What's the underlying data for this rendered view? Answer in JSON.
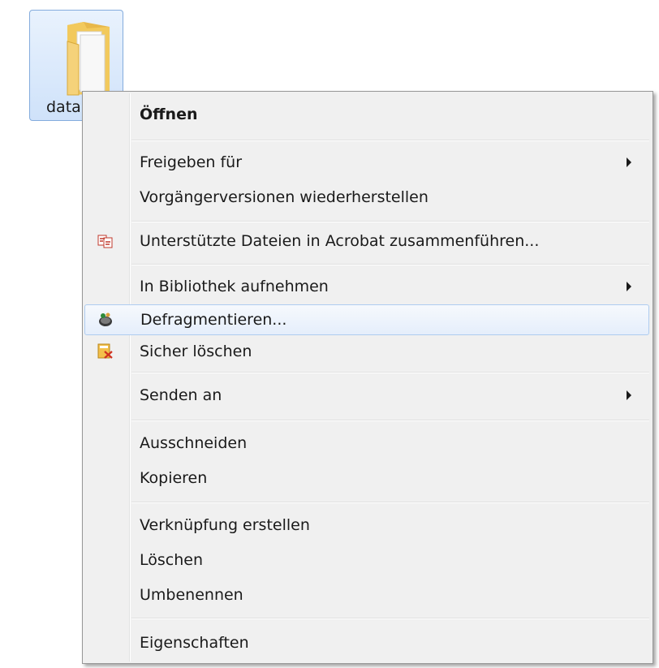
{
  "desktop": {
    "folder_label": "data"
  },
  "context_menu": {
    "items": [
      {
        "id": "open",
        "label": "Öffnen",
        "bold": true
      },
      {
        "id": "share-with",
        "label": "Freigeben für",
        "submenu": true
      },
      {
        "id": "restore-previous-versions",
        "label": "Vorgängerversionen wiederherstellen"
      },
      {
        "id": "combine-acrobat",
        "label": "Unterstützte Dateien in Acrobat zusammenführen...",
        "icon": "acrobat-icon"
      },
      {
        "id": "include-in-library",
        "label": "In Bibliothek aufnehmen",
        "submenu": true
      },
      {
        "id": "defragment",
        "label": "Defragmentieren...",
        "icon": "defrag-icon",
        "hover": true
      },
      {
        "id": "secure-delete",
        "label": "Sicher löschen",
        "icon": "secure-delete-icon"
      },
      {
        "id": "send-to",
        "label": "Senden an",
        "submenu": true
      },
      {
        "id": "cut",
        "label": "Ausschneiden"
      },
      {
        "id": "copy",
        "label": "Kopieren"
      },
      {
        "id": "create-shortcut",
        "label": "Verknüpfung erstellen"
      },
      {
        "id": "delete",
        "label": "Löschen"
      },
      {
        "id": "rename",
        "label": "Umbenennen"
      },
      {
        "id": "properties",
        "label": "Eigenschaften"
      }
    ]
  },
  "colors": {
    "hover_border": "#aeccf0",
    "menu_background": "#f0f0f0",
    "selection_background": "#cfe2fa"
  }
}
